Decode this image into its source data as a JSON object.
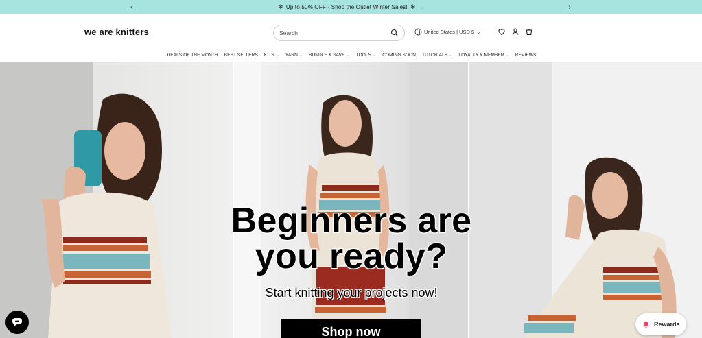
{
  "announcement": {
    "message": "Up to 50% OFF · Shop the Outlet Winter Sales!",
    "prev_icon": "chevron-left-icon",
    "next_icon": "chevron-right-icon",
    "arrow": "→",
    "prev": "‹",
    "next": "›",
    "flake": "❄",
    "bg_color": "#a7e3df"
  },
  "header": {
    "logo": "we are knitters",
    "search_placeholder": "Search",
    "locale": "United States | USD $",
    "locale_chevron": "⌄"
  },
  "nav": {
    "items": [
      {
        "label": "DEALS OF THE MONTH",
        "chev": ""
      },
      {
        "label": "BEST SELLERS",
        "chev": ""
      },
      {
        "label": "KITS",
        "chev": "⌄"
      },
      {
        "label": "YARN",
        "chev": "⌄"
      },
      {
        "label": "BUNDLE & SAVE",
        "chev": "⌄"
      },
      {
        "label": "TOOLS",
        "chev": "⌄"
      },
      {
        "label": "COMING SOON",
        "chev": ""
      },
      {
        "label": "TUTORIALS",
        "chev": "⌄"
      },
      {
        "label": "LOYALTY & MEMBER",
        "chev": "⌄"
      },
      {
        "label": "REVIEWS",
        "chev": ""
      }
    ]
  },
  "hero": {
    "title_line1": "Beginners are",
    "title_line2": "you ready?",
    "subtitle": "Start knitting your projects now!",
    "cta": "Shop now"
  },
  "widgets": {
    "rewards_label": "Rewards",
    "accent_color": "#e8466a"
  }
}
